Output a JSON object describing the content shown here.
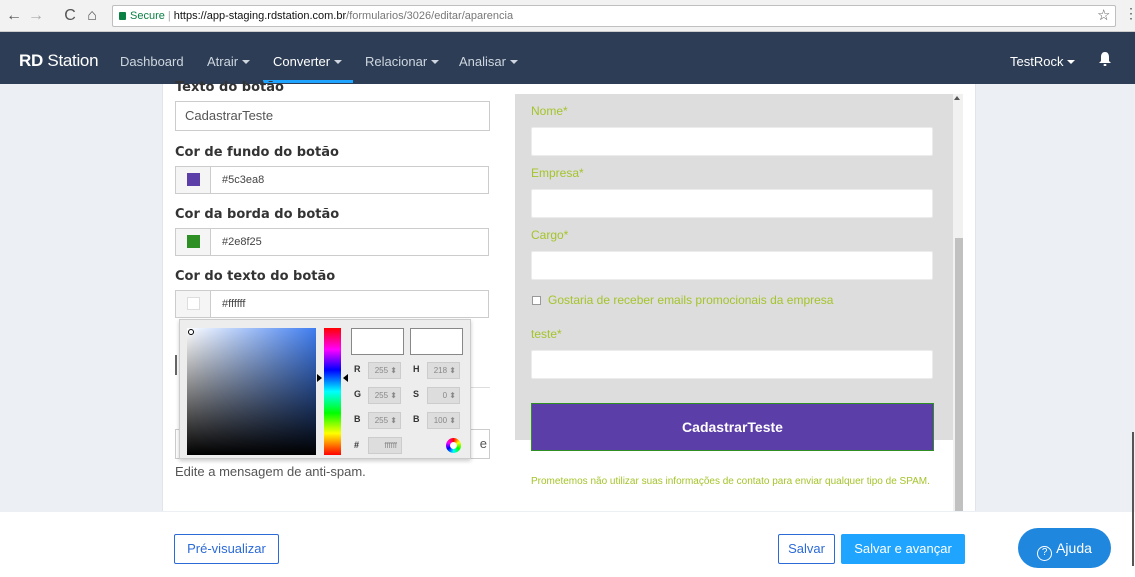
{
  "browser": {
    "secure_label": "Secure",
    "url_host": "https://app-staging.rdstation.com.br",
    "url_path": "/formularios/3026/editar/aparencia"
  },
  "navbar": {
    "logo_bold": "RD",
    "logo_rest": "Station",
    "items": [
      {
        "label": "Dashboard"
      },
      {
        "label": "Atrair"
      },
      {
        "label": "Converter"
      },
      {
        "label": "Relacionar"
      },
      {
        "label": "Analisar"
      }
    ],
    "user": "TestRock"
  },
  "editor": {
    "button_text_label": "Texto do botão",
    "button_text_value": "CadastrarTeste",
    "bg_color_label": "Cor de fundo do botão",
    "bg_color_value": "#5c3ea8",
    "border_color_label": "Cor da borda do botão",
    "border_color_value": "#2e8f25",
    "text_color_label": "Cor do texto do botão",
    "text_color_value": "#ffffff",
    "antispam_hint": "Edite a mensagem de anti-spam.",
    "antispam_input_tail": "e"
  },
  "colorpicker": {
    "r": "255",
    "g": "255",
    "b": "255",
    "h": "218",
    "s": "0",
    "br": "100",
    "hex": "ffffff",
    "labels": {
      "r": "R",
      "g": "G",
      "b": "B",
      "h": "H",
      "s": "S",
      "br": "B",
      "hex": "#"
    }
  },
  "form_preview": {
    "fields": [
      {
        "label": "Nome*"
      },
      {
        "label": "Empresa*"
      },
      {
        "label": "Cargo*"
      },
      {
        "label": "teste*"
      }
    ],
    "checkbox_label": "Gostaria de receber emails promocionais da empresa",
    "submit_label": "CadastrarTeste",
    "privacy_text": "Prometemos não utilizar suas informações de contato para enviar qualquer tipo de SPAM."
  },
  "footer": {
    "preview_button": "Pré-visualizar",
    "save_button": "Salvar",
    "save_next_button": "Salvar e avançar",
    "help_button": "Ajuda"
  },
  "colors": {
    "navbar": "#2c3d55",
    "accent": "#1fa5ff",
    "label_green": "#a4c42b",
    "button_bg": "#5c3ea8",
    "button_border": "#2e8f25"
  }
}
